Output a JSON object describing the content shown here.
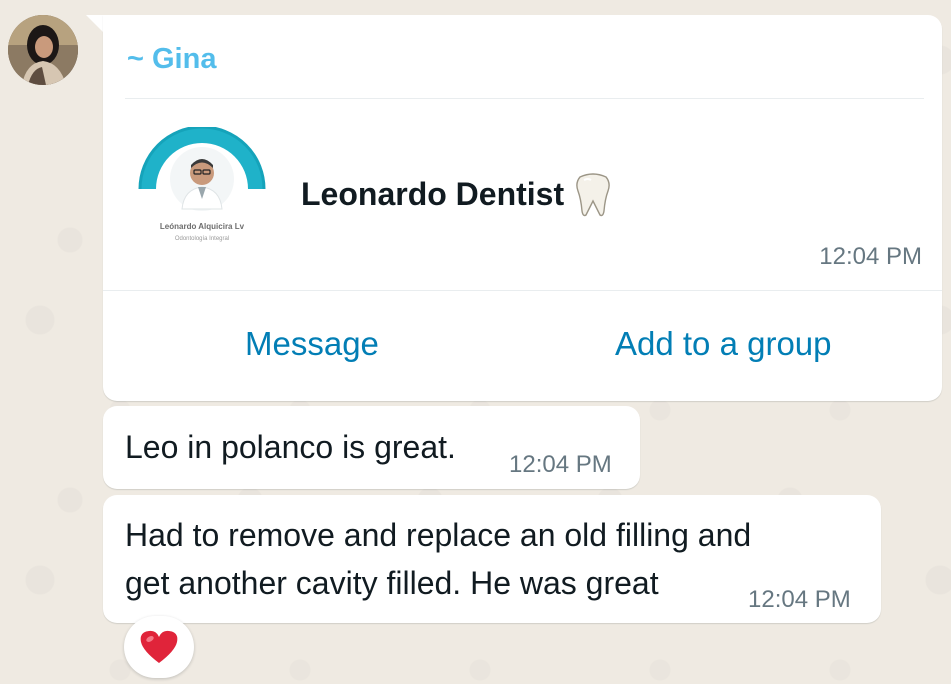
{
  "sender": {
    "name": "~ Gina",
    "avatar_icon": "profile-photo"
  },
  "contact_card": {
    "contact_name": "Leonardo Dentist",
    "emoji_icon": "tooth-icon",
    "photo_caption": "Leónardo Alquicira Lv",
    "photo_subcaption": "Odontología Integral",
    "time": "12:04 PM",
    "actions": {
      "message_label": "Message",
      "add_group_label": "Add to a group"
    }
  },
  "messages": [
    {
      "text": "Leo in polanco is great.",
      "time": "12:04 PM"
    },
    {
      "line1": "Had to remove and replace an old filling and",
      "line2": "get another cavity filled. He was great",
      "time": "12:04 PM"
    }
  ],
  "reaction": {
    "icon": "heart-icon",
    "color": "#e0243a"
  },
  "colors": {
    "sender_name": "#53bdeb",
    "action_link": "#027eb5",
    "timestamp": "#667781",
    "text": "#111b21",
    "wallpaper": "#efeae2"
  }
}
